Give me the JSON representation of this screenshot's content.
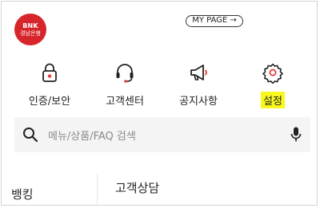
{
  "header": {
    "logo": {
      "line1": "BNK",
      "line2": "경남은행",
      "color": "#d7262b"
    },
    "mypage_label": "MY PAGE",
    "mypage_arrow": "→"
  },
  "quick_menu": [
    {
      "label": "인증/보안",
      "icon": "lock-icon",
      "highlighted": false
    },
    {
      "label": "고객센터",
      "icon": "headset-icon",
      "highlighted": false
    },
    {
      "label": "공지사항",
      "icon": "megaphone-icon",
      "highlighted": false
    },
    {
      "label": "설정",
      "icon": "gear-icon",
      "highlighted": true,
      "highlight_color": "#f8f81d"
    }
  ],
  "search": {
    "placeholder": "메뉴/상품/FAQ 검색",
    "icon": "search-icon",
    "voice_icon": "microphone-icon"
  },
  "bottom": {
    "left_category": "뱅킹",
    "section_title": "고객상담"
  },
  "colors": {
    "accent": "#d7262b",
    "lock_accent": "#e83a3a"
  }
}
